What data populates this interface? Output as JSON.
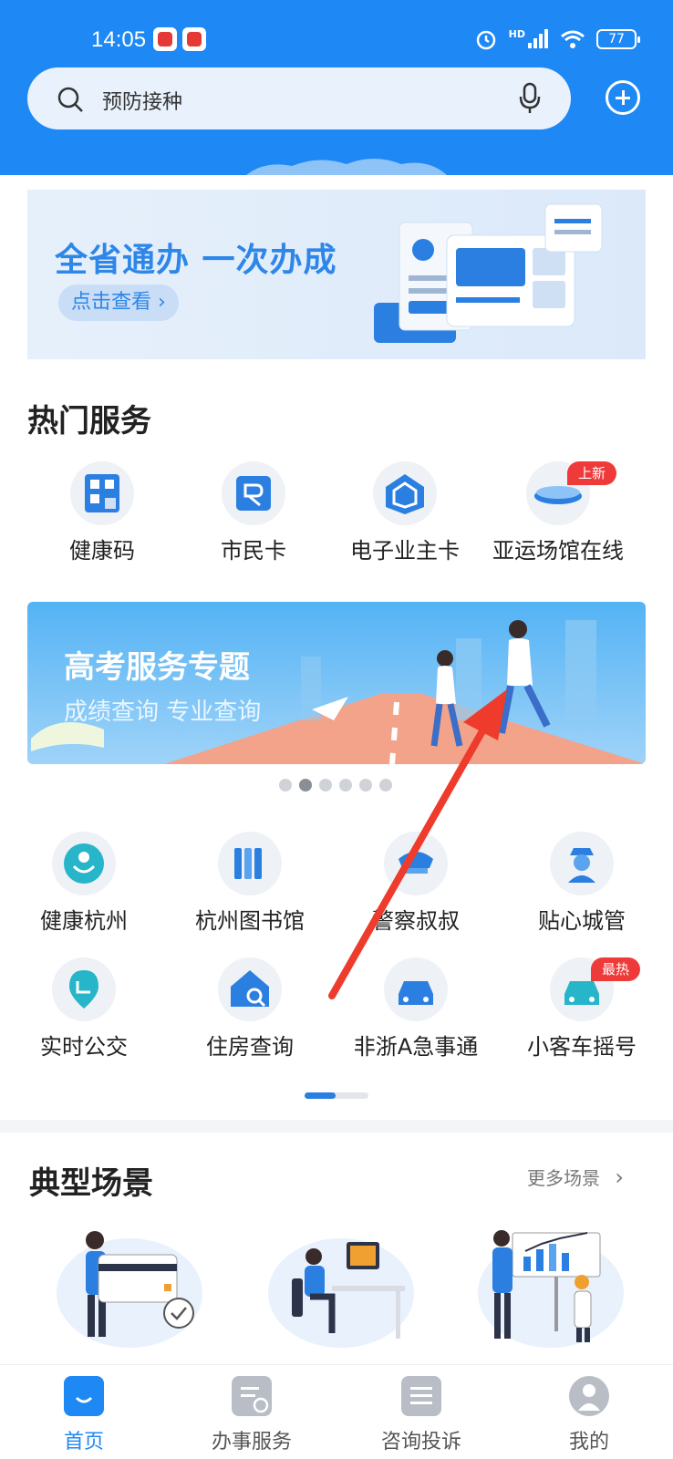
{
  "status_bar": {
    "time": "14:05",
    "battery": "77",
    "signal_label": "HD"
  },
  "search": {
    "placeholder": "预防接种"
  },
  "banner_top": {
    "title": "全省通办 一次办成",
    "button": "点击查看 ›"
  },
  "hot_services": {
    "title": "热门服务",
    "items": [
      {
        "label": "健康码",
        "icon": "health-code-icon"
      },
      {
        "label": "市民卡",
        "icon": "citizen-card-icon"
      },
      {
        "label": "电子业主卡",
        "icon": "owner-card-icon"
      },
      {
        "label": "亚运场馆在线",
        "icon": "stadium-icon",
        "badge": "上新"
      }
    ]
  },
  "banner_exam": {
    "title": "高考服务专题",
    "subtitle": "成绩查询 专业查询"
  },
  "carousel": {
    "count": 6,
    "active": 1
  },
  "services_grid": {
    "items": [
      {
        "label": "健康杭州",
        "icon": "health-hangzhou-icon"
      },
      {
        "label": "杭州图书馆",
        "icon": "library-icon"
      },
      {
        "label": "警察叔叔",
        "icon": "police-icon"
      },
      {
        "label": "贴心城管",
        "icon": "city-management-icon"
      },
      {
        "label": "实时公交",
        "icon": "bus-icon"
      },
      {
        "label": "住房查询",
        "icon": "housing-icon"
      },
      {
        "label": "非浙A急事通",
        "icon": "car-emergency-icon"
      },
      {
        "label": "小客车摇号",
        "icon": "car-lottery-icon",
        "badge": "最热"
      }
    ]
  },
  "scenes": {
    "title": "典型场景",
    "more": "更多场景"
  },
  "bottom_nav": {
    "items": [
      {
        "label": "首页",
        "icon": "home-icon",
        "active": true
      },
      {
        "label": "办事服务",
        "icon": "service-icon"
      },
      {
        "label": "咨询投诉",
        "icon": "complaint-icon"
      },
      {
        "label": "我的",
        "icon": "profile-icon"
      }
    ]
  },
  "colors": {
    "brand": "#1e88f5",
    "badge": "#ef3a3a",
    "arrow": "#ee3b2b"
  }
}
